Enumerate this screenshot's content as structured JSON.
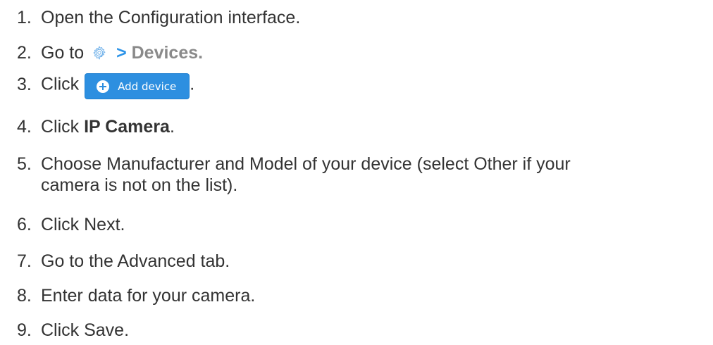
{
  "steps": [
    {
      "num": "1.",
      "text": "Open the Configuration interface."
    },
    {
      "num": "2.",
      "prefix": "Go to",
      "nav_sep": ">",
      "nav_target": "Devices."
    },
    {
      "num": "3.",
      "prefix": "Click",
      "button_label": "Add device",
      "suffix": "."
    },
    {
      "num": "4.",
      "prefix": "Click ",
      "bold": "IP Camera",
      "suffix": "."
    },
    {
      "num": "5.",
      "text_line1": "Choose Manufacturer and Model of your device (select Other if your",
      "text_line2": "camera is not on the list)."
    },
    {
      "num": "6.",
      "text": "Click Next."
    },
    {
      "num": "7.",
      "text": "Go to the Advanced tab."
    },
    {
      "num": "8.",
      "text": "Enter data for your camera."
    },
    {
      "num": "9.",
      "text": "Click Save."
    }
  ],
  "icons": {
    "settings": "gear-icon",
    "add": "plus-icon"
  },
  "colors": {
    "text": "#333333",
    "accent": "#2b93e8",
    "muted": "#8a8a8a",
    "button": "#2d8fe0"
  }
}
